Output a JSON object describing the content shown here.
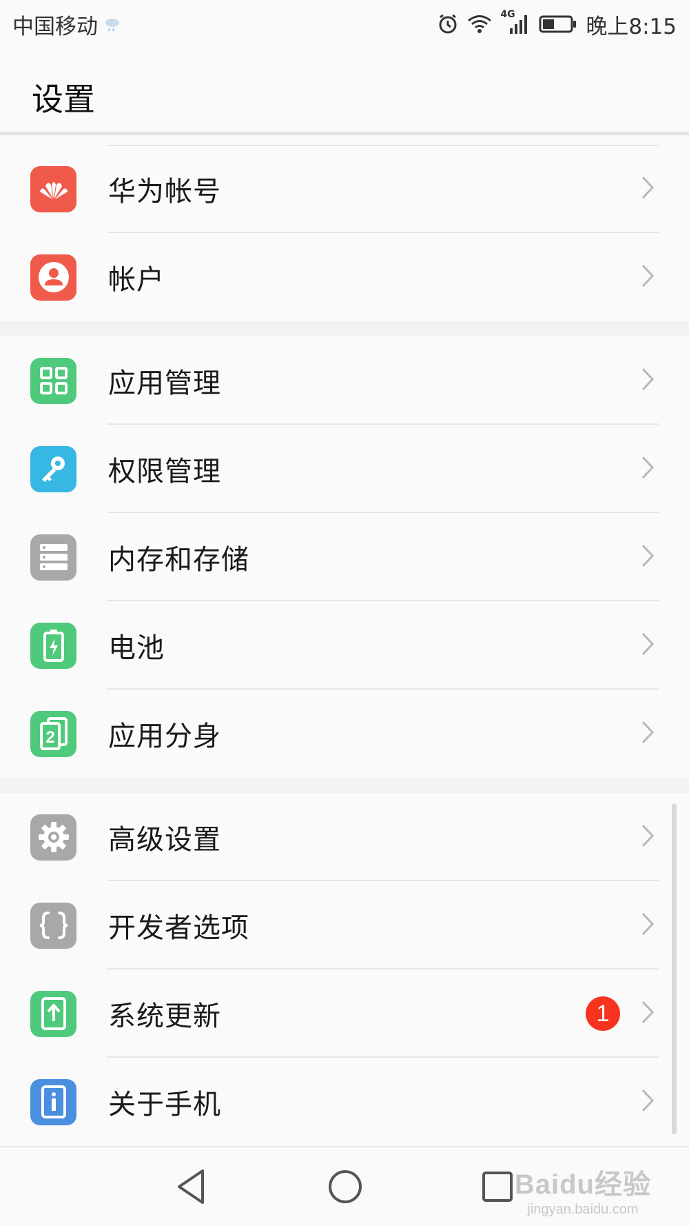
{
  "status_bar": {
    "carrier": "中国移动",
    "network_type": "4G",
    "time": "晚上8:15"
  },
  "header": {
    "title": "设置"
  },
  "groups": [
    {
      "items": [
        {
          "label": "华为帐号",
          "icon": "huawei-logo-icon",
          "color": "#f05a4a"
        },
        {
          "label": "帐户",
          "icon": "user-icon",
          "color": "#f05a4a"
        }
      ]
    },
    {
      "items": [
        {
          "label": "应用管理",
          "icon": "apps-grid-icon",
          "color": "#4fc97b"
        },
        {
          "label": "权限管理",
          "icon": "key-icon",
          "color": "#37b7e3"
        },
        {
          "label": "内存和存储",
          "icon": "storage-icon",
          "color": "#a8a8a8"
        },
        {
          "label": "电池",
          "icon": "battery-icon",
          "color": "#4fc97b"
        },
        {
          "label": "应用分身",
          "icon": "app-twin-icon",
          "color": "#4fc97b"
        }
      ]
    },
    {
      "items": [
        {
          "label": "高级设置",
          "icon": "gear-icon",
          "color": "#a8a8a8"
        },
        {
          "label": "开发者选项",
          "icon": "braces-icon",
          "color": "#a8a8a8"
        },
        {
          "label": "系统更新",
          "icon": "system-update-icon",
          "color": "#4fc97b",
          "badge": "1"
        },
        {
          "label": "关于手机",
          "icon": "info-icon",
          "color": "#4b8fe0"
        }
      ]
    }
  ],
  "watermark": {
    "line1": "Baidu经验",
    "line2": "jingyan.baidu.com"
  }
}
